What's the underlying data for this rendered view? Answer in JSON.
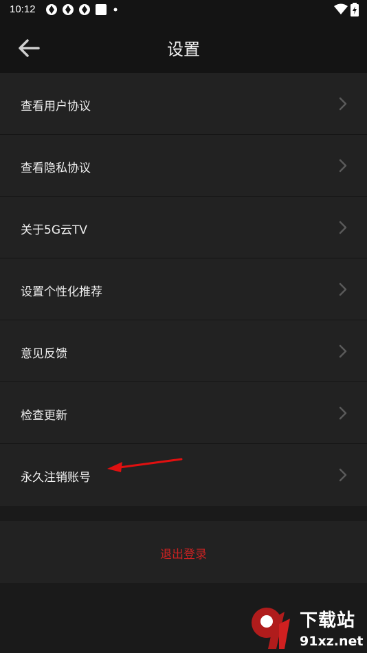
{
  "status_bar": {
    "time": "10:12",
    "left_icons": [
      "sync-icon",
      "sync-icon",
      "sync-icon",
      "square-icon",
      "dot-icon"
    ],
    "right_icons": [
      "wifi-icon",
      "battery-icon"
    ]
  },
  "header": {
    "title": "设置",
    "back_icon": "arrow-left-icon"
  },
  "menu": {
    "items": [
      {
        "label": "查看用户协议"
      },
      {
        "label": "查看隐私协议"
      },
      {
        "label": "关于5G云TV"
      },
      {
        "label": "设置个性化推荐"
      },
      {
        "label": "意见反馈"
      },
      {
        "label": "检查更新"
      },
      {
        "label": "永久注销账号"
      }
    ]
  },
  "logout": {
    "label": "退出登录"
  },
  "watermark": {
    "title": "下载站",
    "url": "91xz.net"
  },
  "colors": {
    "background": "#1a1a1a",
    "header": "#141414",
    "card": "#222222",
    "logout_text": "#cc2222",
    "annotation_arrow": "#e01010"
  }
}
